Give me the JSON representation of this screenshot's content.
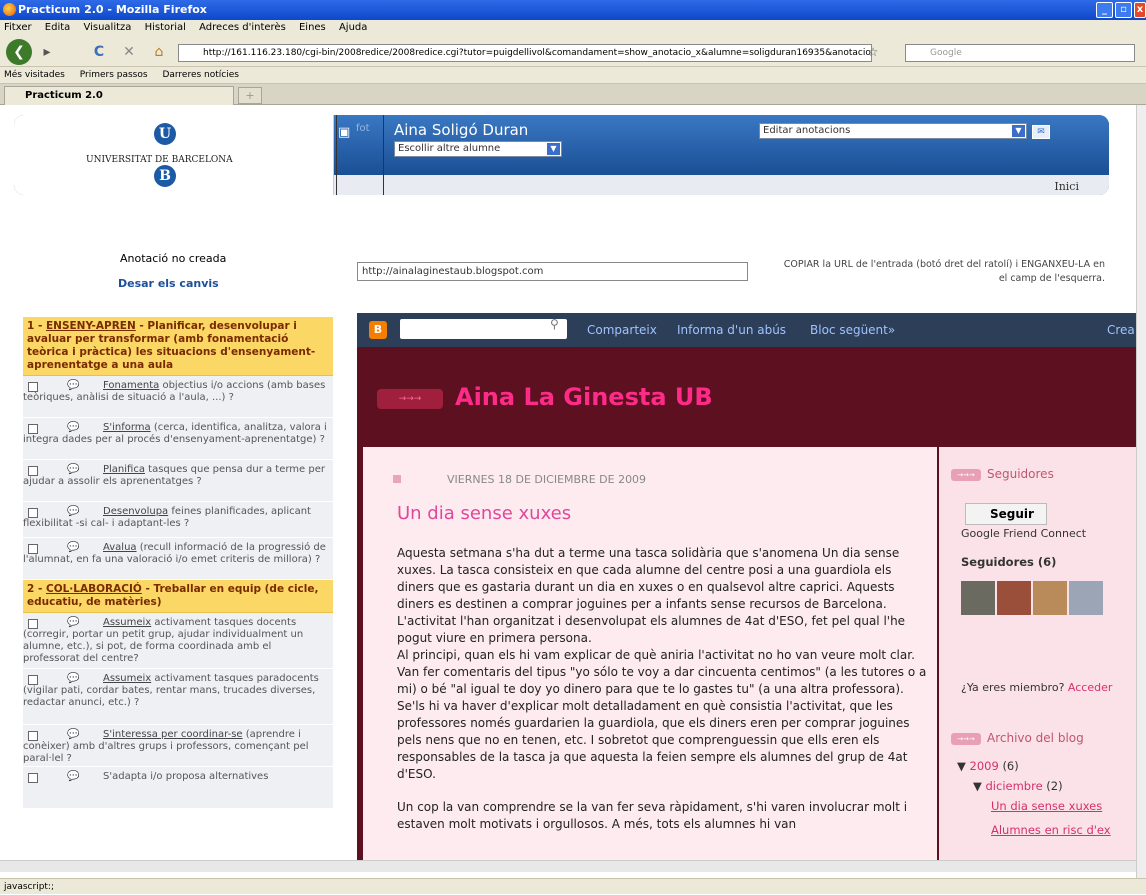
{
  "window": {
    "title": "Practicum 2.0 - Mozilla Firefox"
  },
  "menu": [
    "Fitxer",
    "Edita",
    "Visualitza",
    "Historial",
    "Adreces d'interès",
    "Eines",
    "Ajuda"
  ],
  "nav": {
    "url": "http://161.116.23.180/cgi-bin/2008redice/2008redice.cgi?tutor=puigdellivol&comandament=show_anotacio_x&alumne=soligduran16935&anotacio=0",
    "search_placeholder": "Google"
  },
  "bookmarks": [
    "Més visitades",
    "Primers passos",
    "Darreres notícies"
  ],
  "tabs": [
    {
      "label": "Practicum 2.0"
    }
  ],
  "status": "javascript:;",
  "header": {
    "university": "UNIVERSITAT DE BARCELONA",
    "photo_label": "fot",
    "student_name": "Aina Soligó Duran",
    "student_select": "Escollir altre alumne",
    "annotations_select": "Editar anotacions",
    "home": "Inici"
  },
  "left": {
    "status_text": "Anotació no creada",
    "save_link": "Desar els canvis",
    "url_value": "http://ainalaginestaub.blogspot.com",
    "copy_hint": "COPIAR la URL de l'entrada (botó dret del ratolí) i ENGANXEU-LA en el camp de l'esquerra.",
    "sections": [
      {
        "number": "1 - ",
        "key": "ENSENY-APREN",
        "rest": " - Planificar, desenvolupar i avaluar per transformar (amb fonamentació teòrica i pràctica) les situacions d'ensenyament-aprenentatge a una aula",
        "items": [
          {
            "verb": "Fonamenta",
            "text": " objectius i/o accions (amb bases teòriques, anàlisi de situació a l'aula, ...) ?"
          },
          {
            "verb": "S'informa",
            "text": " (cerca, identifica, analitza, valora i integra dades per al procés d'ensenyament-aprenentatge) ?"
          },
          {
            "verb": "Planifica",
            "text": " tasques que pensa dur a terme per ajudar a assolir els aprenentatges ?"
          },
          {
            "verb": "Desenvolupa",
            "text": " feines planificades, aplicant flexibilitat -si cal- i adaptant-les ?"
          },
          {
            "verb": "Avalua",
            "text": " (recull informació de la progressió de l'alumnat, en fa una valoració i/o emet criteris de millora) ?"
          }
        ]
      },
      {
        "number": "2 - ",
        "key": "COL·LABORACIÓ",
        "rest": " - Treballar en equip (de cicle, educatiu, de matèries)",
        "items": [
          {
            "verb": "Assumeix",
            "text": " activament tasques docents (corregir, portar un petit grup, ajudar individualment un alumne, etc.), si pot, de forma coordinada amb el professorat del centre?"
          },
          {
            "verb": "Assumeix",
            "text": " activament tasques paradocents (vigilar pati, cordar bates, rentar mans, trucades diverses, redactar anunci, etc.) ?"
          },
          {
            "verb": "S'interessa per coordinar-se",
            "text": " (aprendre i conèixer) amb d'altres grups i professors, començant pel paral·lel ?"
          },
          {
            "verb": "",
            "text": "S'adapta i/o proposa alternatives"
          }
        ]
      }
    ]
  },
  "blog": {
    "bar_links": [
      "Comparteix",
      "Informa d'un abús",
      "Bloc següent»",
      "Crea"
    ],
    "title": "Aina La Ginesta UB",
    "date": "VIERNES 18 DE DICIEMBRE DE 2009",
    "post_title": "Un dia sense xuxes",
    "paragraphs": [
      "Aquesta setmana s'ha dut a terme una tasca solidària que s'anomena Un dia sense xuxes. La tasca consisteix en que cada alumne del centre posi a una guardiola els diners que es gastaria durant un dia en xuxes o en qualsevol altre caprici. Aquests diners es destinen a comprar joguines per a infants sense recursos de Barcelona. L'activitat l'han organitzat i desenvolupat els alumnes de 4at d'ESO, fet pel qual l'he pogut viure en primera persona.",
      "Al principi, quan els hi vam explicar de què aniria l'activitat no ho van veure molt clar. Van fer comentaris del tipus \"yo sólo te voy a dar cincuenta centimos\" (a les tutores o a mi) o bé \"al igual te doy yo dinero para que te lo gastes tu\" (a una altra professora). Se'ls hi va haver d'explicar molt detalladament en què consistia l'activitat, que les professores només guardarien la guardiola, que els diners eren per comprar joguines pels nens que no en tenen, etc. I sobretot que comprenguessin que ells eren els responsables de la tasca ja que aquesta la feien sempre els alumnes del grup de 4at d'ESO.",
      "Un cop la van comprendre se la van fer seva ràpidament, s'hi varen involucrar molt i estaven molt motivats i orgullosos. A més, tots els alumnes hi van"
    ],
    "sidebar": {
      "followers_head": "Seguidores",
      "follow_btn": "Seguir",
      "gfc": "Google Friend Connect",
      "followers_count": "Seguidores (6)",
      "member_q": "¿Ya eres miembro?",
      "member_link": "Acceder",
      "archive_head": "Archivo del blog",
      "year": "2009",
      "year_count": "(6)",
      "month": "diciembre",
      "month_count": "(2)",
      "posts": [
        "Un dia sense xuxes",
        "Alumnes en risc d'ex"
      ]
    }
  }
}
